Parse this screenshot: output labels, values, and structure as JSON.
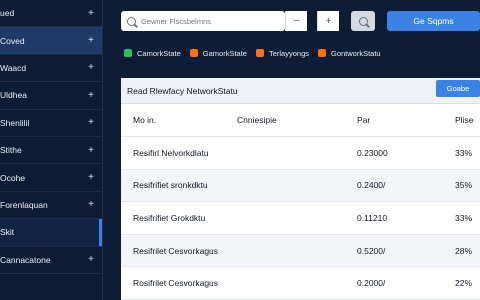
{
  "sidebar": {
    "items": [
      {
        "label": "ued",
        "icon": "plus-icon"
      },
      {
        "label": "Coved",
        "icon": "plus-icon"
      },
      {
        "label": "Waacd",
        "icon": "plus-icon"
      },
      {
        "label": "Uldhea",
        "icon": "plus-icon"
      },
      {
        "label": "Shenlilil",
        "icon": "plus-icon"
      },
      {
        "label": "Stithe",
        "icon": "plus-icon"
      },
      {
        "label": "Ocohe",
        "icon": "plus-icon"
      },
      {
        "label": "Forenlaquan",
        "icon": "plus-icon"
      },
      {
        "label": "Skit",
        "icon": ""
      },
      {
        "label": "Cannacatone",
        "icon": "plus-icon"
      },
      {
        "label": "",
        "icon": ""
      }
    ]
  },
  "topbar": {
    "search_placeholder": "Gewner Flscsbelmns",
    "btn_minus": "−",
    "btn_plus": "+",
    "primary_label": "Ge Sqpms"
  },
  "chips": [
    {
      "label": "CamorkState",
      "color": "#22c55e"
    },
    {
      "label": "GamorkState",
      "color": "#f97316"
    },
    {
      "label": "Terlayyongs",
      "color": "#f97316"
    },
    {
      "label": "GontworkStatu",
      "color": "#f97316"
    }
  ],
  "panel": {
    "title": "Read Rlewfacy NetworkStatu",
    "action_label": "Goabe",
    "columns": [
      "Mo in.",
      "Cnniesipie",
      "Par",
      "Plise"
    ],
    "rows": [
      {
        "name": "Resifirl Nelvorkdlatu",
        "col2": "",
        "value": "0.23000",
        "pct": "33%"
      },
      {
        "name": "Resifrifiet sronkdktu",
        "col2": "",
        "value": "0.2400/",
        "pct": "35%"
      },
      {
        "name": "Resifrifiet Grokdktu",
        "col2": "",
        "value": "0.11210",
        "pct": "33%"
      },
      {
        "name": "Resifrilet Cesvorkagus",
        "col2": "",
        "value": "0.5200/",
        "pct": "28%"
      },
      {
        "name": "Rosifrilet Cesvorkagus",
        "col2": "",
        "value": "0.2000/",
        "pct": "22%"
      }
    ]
  }
}
